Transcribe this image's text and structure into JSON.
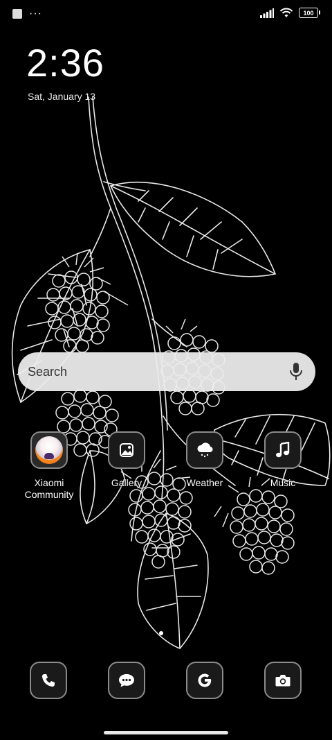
{
  "statusbar": {
    "left_icons": [
      "notification-square-icon",
      "more-dots-icon"
    ],
    "more_dots": "···",
    "right_icons": [
      "signal-icon",
      "wifi-icon",
      "battery-icon"
    ],
    "battery_level": "100"
  },
  "lockscreen": {
    "time": "2:36",
    "date": "Sat, January 13"
  },
  "search": {
    "placeholder": "Search",
    "icon": "mic-icon"
  },
  "apps": [
    {
      "label": "Xiaomi Community",
      "icon": "xiaomi-community-icon"
    },
    {
      "label": "Gallery",
      "icon": "gallery-icon"
    },
    {
      "label": "Weather",
      "icon": "weather-icon"
    },
    {
      "label": "Music",
      "icon": "music-icon"
    }
  ],
  "dock": [
    {
      "icon": "phone-icon"
    },
    {
      "icon": "messages-icon"
    },
    {
      "icon": "google-icon"
    },
    {
      "icon": "camera-icon"
    }
  ],
  "colors": {
    "background": "#000000",
    "search_bar": "#ececec",
    "icon_border": "#8b8b8b",
    "xiaomi_orange": "#ff6a00"
  }
}
